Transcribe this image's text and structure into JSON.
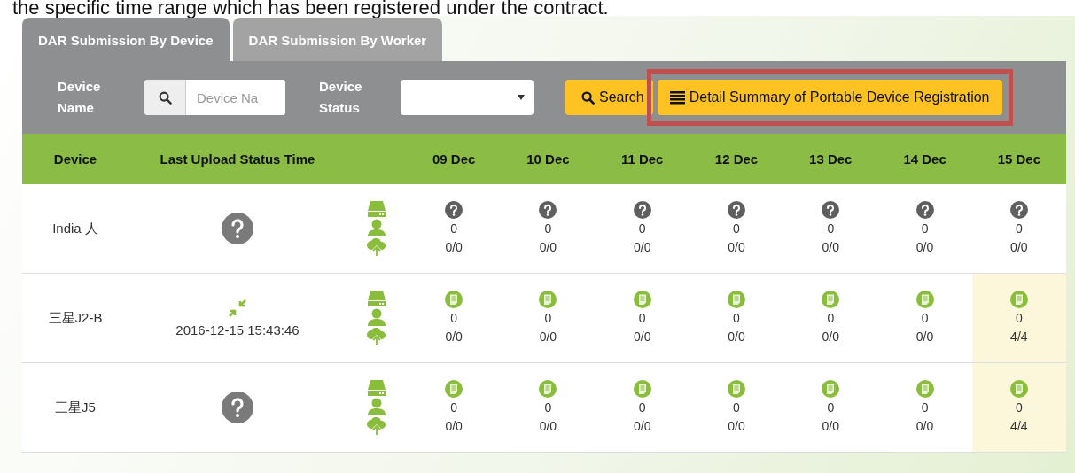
{
  "caption": "the specific time range which has been registered under the contract.",
  "tabs": [
    {
      "label": "DAR Submission By Device",
      "selected": true
    },
    {
      "label": "DAR Submission By Worker",
      "selected": false
    }
  ],
  "filters": {
    "device_name_label": "Device Name",
    "device_name_placeholder": "Device Na",
    "device_status_label": "Device Status",
    "search_button": "Search",
    "summary_button": "Detail Summary of Portable Device Registration",
    "summary_highlighted": true
  },
  "table": {
    "columns": [
      "Device",
      "Last Upload Status Time",
      "",
      "09 Dec",
      "10 Dec",
      "11 Dec",
      "12 Dec",
      "13 Dec",
      "14 Dec",
      "15 Dec"
    ],
    "rows": [
      {
        "device": "India 人",
        "last_upload": {
          "kind": "unknown"
        },
        "days": [
          {
            "kind": "unknown",
            "count": "0",
            "ratio": "0/0",
            "highlighted": false
          },
          {
            "kind": "unknown",
            "count": "0",
            "ratio": "0/0",
            "highlighted": false
          },
          {
            "kind": "unknown",
            "count": "0",
            "ratio": "0/0",
            "highlighted": false
          },
          {
            "kind": "unknown",
            "count": "0",
            "ratio": "0/0",
            "highlighted": false
          },
          {
            "kind": "unknown",
            "count": "0",
            "ratio": "0/0",
            "highlighted": false
          },
          {
            "kind": "unknown",
            "count": "0",
            "ratio": "0/0",
            "highlighted": false
          },
          {
            "kind": "unknown",
            "count": "0",
            "ratio": "0/0",
            "highlighted": false
          }
        ]
      },
      {
        "device": "三星J2-B",
        "last_upload": {
          "kind": "connected",
          "time": "2016-12-15 15:43:46"
        },
        "days": [
          {
            "kind": "document",
            "count": "0",
            "ratio": "0/0",
            "highlighted": false
          },
          {
            "kind": "document",
            "count": "0",
            "ratio": "0/0",
            "highlighted": false
          },
          {
            "kind": "document",
            "count": "0",
            "ratio": "0/0",
            "highlighted": false
          },
          {
            "kind": "document",
            "count": "0",
            "ratio": "0/0",
            "highlighted": false
          },
          {
            "kind": "document",
            "count": "0",
            "ratio": "0/0",
            "highlighted": false
          },
          {
            "kind": "document",
            "count": "0",
            "ratio": "0/0",
            "highlighted": false
          },
          {
            "kind": "document",
            "count": "0",
            "ratio": "4/4",
            "highlighted": true
          }
        ]
      },
      {
        "device": "三星J5",
        "last_upload": {
          "kind": "unknown"
        },
        "days": [
          {
            "kind": "document",
            "count": "0",
            "ratio": "0/0",
            "highlighted": false
          },
          {
            "kind": "document",
            "count": "0",
            "ratio": "0/0",
            "highlighted": false
          },
          {
            "kind": "document",
            "count": "0",
            "ratio": "0/0",
            "highlighted": false
          },
          {
            "kind": "document",
            "count": "0",
            "ratio": "0/0",
            "highlighted": false
          },
          {
            "kind": "document",
            "count": "0",
            "ratio": "0/0",
            "highlighted": false
          },
          {
            "kind": "document",
            "count": "0",
            "ratio": "0/0",
            "highlighted": false
          },
          {
            "kind": "document",
            "count": "0",
            "ratio": "4/4",
            "highlighted": true
          }
        ]
      }
    ]
  }
}
